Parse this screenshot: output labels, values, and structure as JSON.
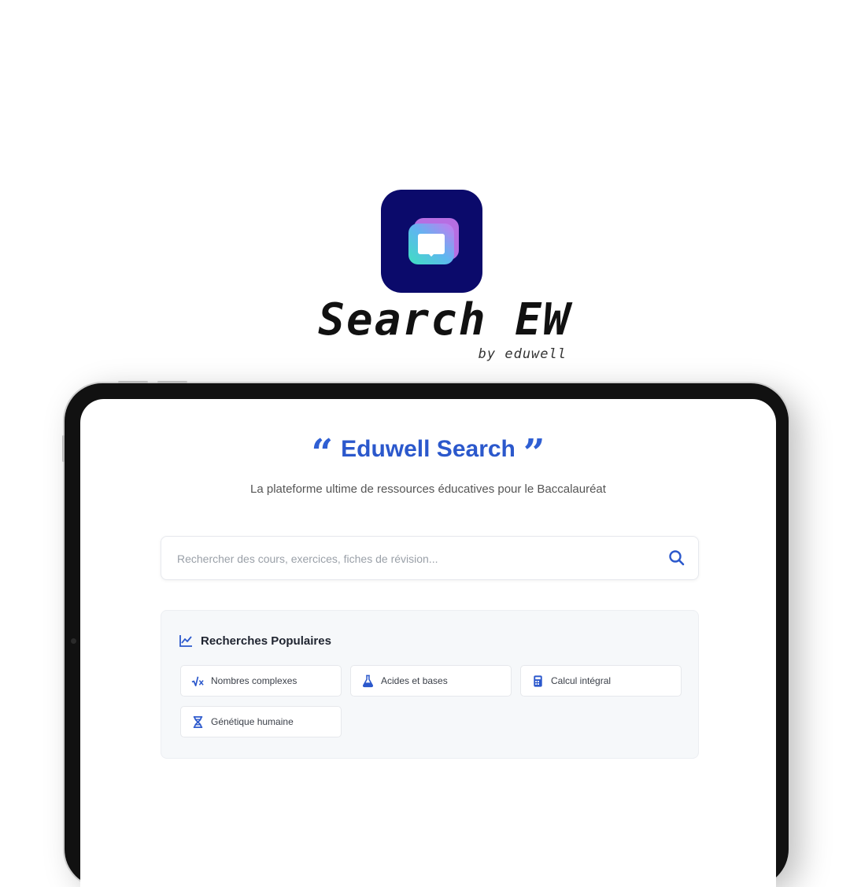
{
  "brand": {
    "title": "Search EW",
    "subtitle": "by eduwell",
    "icon": "book-icon",
    "colors": {
      "icon_bg": "#0b0a6b",
      "gradient_a": "#c979f0",
      "gradient_b": "#3fe0c0"
    }
  },
  "page": {
    "title": "Eduwell Search",
    "quote_open": "“",
    "quote_close": "”",
    "subtitle": "La plateforme ultime de ressources éducatives pour le Baccalauréat",
    "accent_color": "#2b58cc"
  },
  "search": {
    "placeholder": "Rechercher des cours, exercices, fiches de révision...",
    "value": "",
    "icon": "search-icon"
  },
  "popular": {
    "title": "Recherches Populaires",
    "icon": "trend-chart-icon",
    "items": [
      {
        "label": "Nombres complexes",
        "icon": "square-root-icon"
      },
      {
        "label": "Acides et bases",
        "icon": "flask-icon"
      },
      {
        "label": "Calcul intégral",
        "icon": "calculator-icon"
      },
      {
        "label": "Génétique humaine",
        "icon": "dna-icon"
      }
    ]
  }
}
